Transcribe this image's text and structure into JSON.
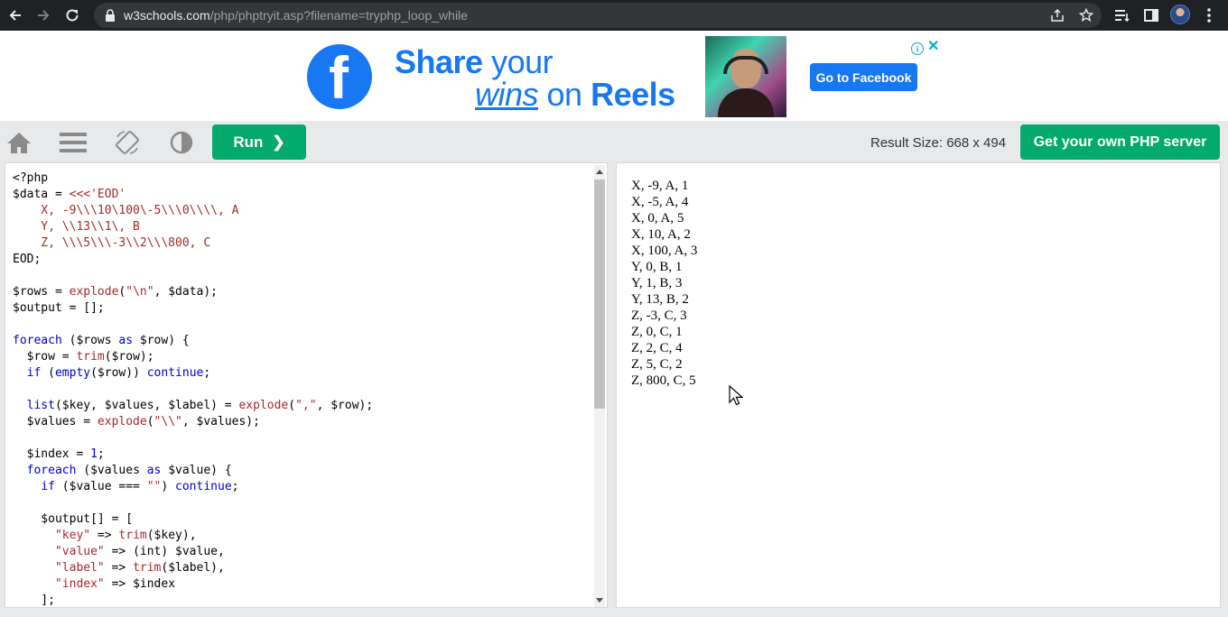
{
  "browser": {
    "url_host": "w3schools.com",
    "url_path": "/php/phptryit.asp?filename=tryphp_loop_while"
  },
  "ad": {
    "brand_letter": "f",
    "headline_share": "Share",
    "headline_your": " your",
    "headline_wins": "wins",
    "headline_on": " on ",
    "headline_reels": "Reels",
    "cta_label": "Go to Facebook",
    "info_glyph": "i",
    "close_glyph": "✕"
  },
  "toolbar": {
    "run_label": "Run",
    "run_chevron": "❯",
    "result_size": "Result Size: 668 x 494",
    "own_server_label": "Get your own PHP server"
  },
  "code_lines": [
    "<?php",
    "$data = <<<'EOD'",
    "    X, -9\\\\\\10\\100\\-5\\\\\\0\\\\\\\\, A",
    "    Y, \\\\13\\\\1\\, B",
    "    Z, \\\\\\5\\\\\\-3\\\\2\\\\\\800, C",
    "EOD;",
    "",
    "$rows = explode(\"\\n\", $data);",
    "$output = [];",
    "",
    "foreach ($rows as $row) {",
    "  $row = trim($row);",
    "  if (empty($row)) continue;",
    "",
    "  list($key, $values, $label) = explode(\",\", $row);",
    "  $values = explode(\"\\\\\", $values);",
    "",
    "  $index = 1;",
    "  foreach ($values as $value) {",
    "    if ($value === \"\") continue;",
    "",
    "    $output[] = [",
    "      \"key\" => trim($key),",
    "      \"value\" => (int) $value,",
    "      \"label\" => trim($label),",
    "      \"index\" => $index",
    "    ];"
  ],
  "output_lines": [
    "X, -9, A, 1",
    "X, -5, A, 4",
    "X, 0, A, 5",
    "X, 10, A, 2",
    "X, 100, A, 3",
    "Y, 0, B, 1",
    "Y, 1, B, 3",
    "Y, 13, B, 2",
    "Z, -3, C, 3",
    "Z, 0, C, 1",
    "Z, 2, C, 4",
    "Z, 5, C, 2",
    "Z, 800, C, 5"
  ],
  "colors": {
    "run_green": "#04aa6d",
    "facebook_blue": "#1877f2",
    "chrome_dark": "#202124"
  }
}
